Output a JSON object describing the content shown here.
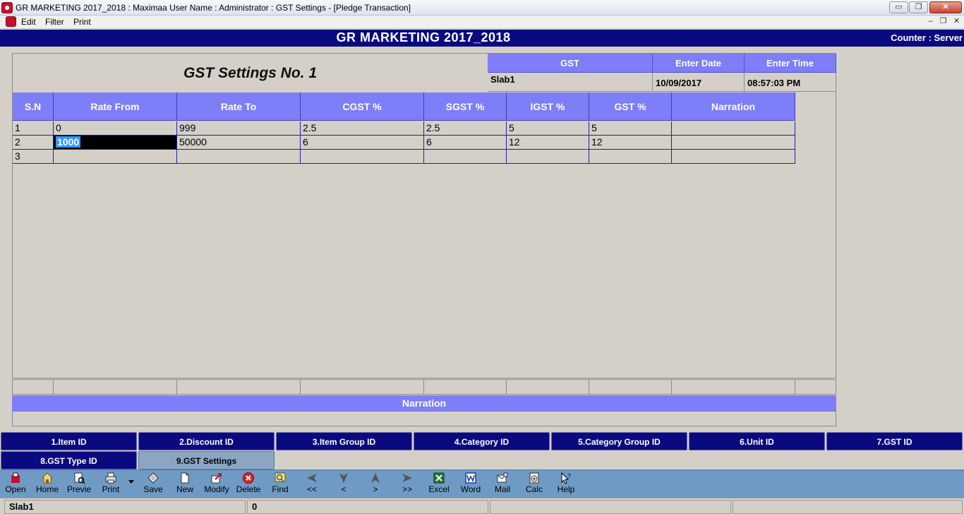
{
  "window": {
    "title": "GR MARKETING 2017_2018 : Maximaa User Name : Administrator : GST Settings  - [Pledge Transaction]",
    "min": "▭",
    "max": "❐",
    "close": "✕"
  },
  "menu": {
    "items": [
      "Edit",
      "Filter",
      "Print"
    ],
    "mdi_min": "–",
    "mdi_restore": "❐",
    "mdi_close": "✕"
  },
  "header": {
    "company": "GR MARKETING 2017_2018",
    "counter": "Counter : Server"
  },
  "form": {
    "title": "GST Settings No.  1",
    "gst_label": "GST",
    "gst_value": "Slab1",
    "date_label": "Enter Date",
    "date_value": "10/09/2017",
    "time_label": "Enter Time",
    "time_value": "08:57:03 PM"
  },
  "grid": {
    "columns": [
      "S.N",
      "Rate From",
      "Rate To",
      "CGST %",
      "SGST %",
      "IGST %",
      "GST %",
      "Narration"
    ],
    "rows": [
      [
        "1",
        "0",
        "999",
        "2.5",
        "2.5",
        "5",
        "5",
        ""
      ],
      [
        "2",
        "1000",
        "50000",
        "6",
        "6",
        "12",
        "12",
        ""
      ],
      [
        "3",
        "",
        "",
        "",
        "",
        "",
        "",
        ""
      ]
    ]
  },
  "narration_label": "Narration",
  "nav_tabs": [
    "1.Item ID",
    "2.Discount ID",
    "3.Item Group ID",
    "4.Category ID",
    "5.Category Group ID",
    "6.Unit ID",
    "7.GST ID",
    "8.GST Type ID",
    "9.GST Settings"
  ],
  "toolbar": {
    "buttons": [
      {
        "label": "Open",
        "icon": "open-icon"
      },
      {
        "label": "Home",
        "icon": "home-icon"
      },
      {
        "label": "Previe",
        "icon": "preview-icon"
      },
      {
        "label": "Print",
        "icon": "printer-icon"
      },
      {
        "label": "Save",
        "icon": "save-icon"
      },
      {
        "label": "New",
        "icon": "new-document-icon"
      },
      {
        "label": "Modify",
        "icon": "modify-icon"
      },
      {
        "label": "Delete",
        "icon": "delete-icon"
      },
      {
        "label": "Find",
        "icon": "find-icon"
      },
      {
        "label": "<<",
        "icon": "first-record-icon"
      },
      {
        "label": "<",
        "icon": "previous-record-icon"
      },
      {
        "label": ">",
        "icon": "next-record-icon"
      },
      {
        "label": ">>",
        "icon": "last-record-icon"
      },
      {
        "label": "Excel",
        "icon": "excel-icon"
      },
      {
        "label": "Word",
        "icon": "word-icon"
      },
      {
        "label": "Mail",
        "icon": "mail-icon"
      },
      {
        "label": "Calc",
        "icon": "calculator-icon"
      },
      {
        "label": "Help",
        "icon": "help-icon"
      }
    ]
  },
  "status": {
    "panel1": "Slab1",
    "panel2": "0",
    "panel3": "",
    "panel4": ""
  },
  "colors": {
    "header_bg": "#0a0a80",
    "grid_header_bg": "#7e7ef8",
    "toolbar_bg": "#6f9ac4",
    "selection": "#3399ff"
  }
}
